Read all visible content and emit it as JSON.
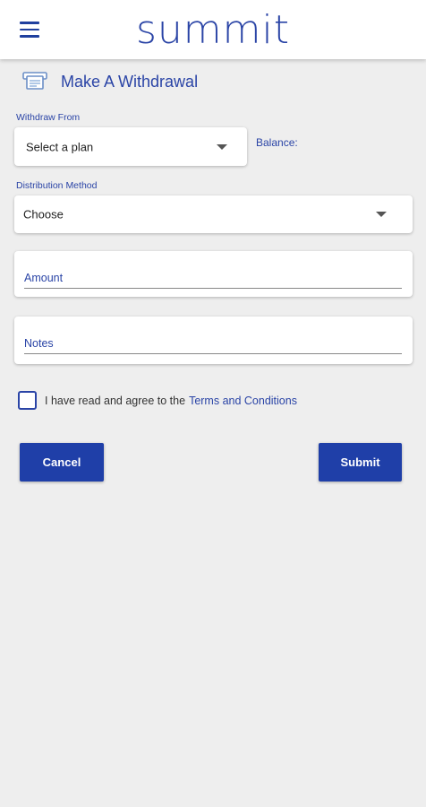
{
  "header": {
    "logo": "summit"
  },
  "page": {
    "title": "Make A Withdrawal"
  },
  "withdraw_from": {
    "label": "Withdraw From",
    "selected": "Select a plan"
  },
  "balance": {
    "label": "Balance:"
  },
  "distribution": {
    "label": "Distribution Method",
    "selected": "Choose"
  },
  "amount": {
    "label": "Amount"
  },
  "notes": {
    "label": "Notes"
  },
  "agreement": {
    "text": "I have read and agree to the",
    "link": "Terms and Conditions"
  },
  "buttons": {
    "cancel": "Cancel",
    "submit": "Submit"
  },
  "colors": {
    "brand": "#2a44a6",
    "button": "#1f3fa8",
    "background": "#eeeeee"
  }
}
